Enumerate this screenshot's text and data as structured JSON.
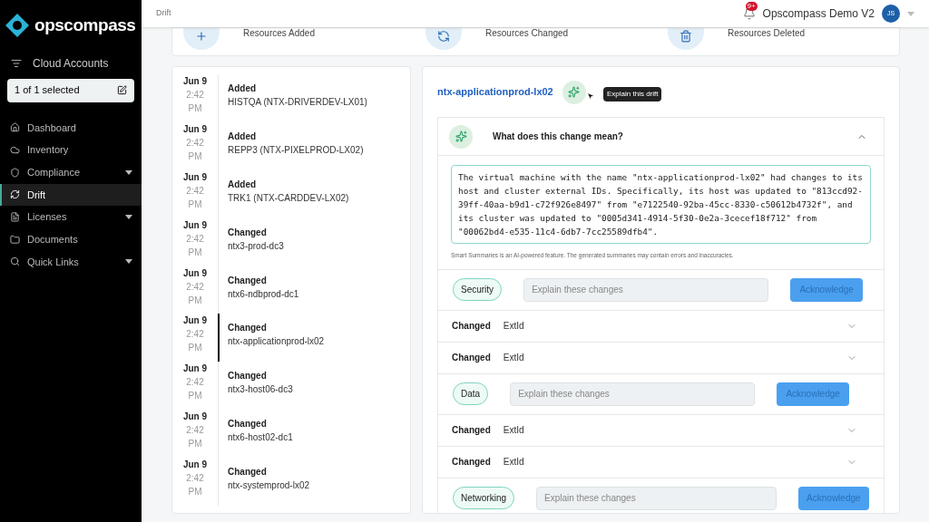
{
  "brand": {
    "name": "opscompass"
  },
  "sidebar": {
    "filter_label": "Cloud Accounts",
    "account_selector": "1 of 1 selected",
    "items": [
      {
        "label": "Dashboard",
        "expandable": false,
        "selected": false
      },
      {
        "label": "Inventory",
        "expandable": false,
        "selected": false
      },
      {
        "label": "Compliance",
        "expandable": true,
        "selected": false
      },
      {
        "label": "Drift",
        "expandable": false,
        "selected": true
      },
      {
        "label": "Licenses",
        "expandable": true,
        "selected": false
      },
      {
        "label": "Documents",
        "expandable": false,
        "selected": false
      },
      {
        "label": "Quick Links",
        "expandable": true,
        "selected": false
      }
    ]
  },
  "header": {
    "breadcrumb": "Drift",
    "notification_badge": "9+",
    "account": "Opscompass Demo V2",
    "avatar": "JS"
  },
  "stats": [
    {
      "label": "Resources Added"
    },
    {
      "label": "Resources Changed"
    },
    {
      "label": "Resources Deleted"
    }
  ],
  "feed": [
    {
      "date": "Jun 9",
      "time": "2:42",
      "ampm": "PM",
      "action": "Added",
      "resource": "HISTQA (NTX-DRIVERDEV-LX01)",
      "selected": false
    },
    {
      "date": "Jun 9",
      "time": "2:42",
      "ampm": "PM",
      "action": "Added",
      "resource": "REPP3 (NTX-PIXELPROD-LX02)",
      "selected": false
    },
    {
      "date": "Jun 9",
      "time": "2:42",
      "ampm": "PM",
      "action": "Added",
      "resource": "TRK1 (NTX-CARDDEV-LX02)",
      "selected": false
    },
    {
      "date": "Jun 9",
      "time": "2:42",
      "ampm": "PM",
      "action": "Changed",
      "resource": "ntx3-prod-dc3",
      "selected": false
    },
    {
      "date": "Jun 9",
      "time": "2:42",
      "ampm": "PM",
      "action": "Changed",
      "resource": "ntx6-ndbprod-dc1",
      "selected": false
    },
    {
      "date": "Jun 9",
      "time": "2:42",
      "ampm": "PM",
      "action": "Changed",
      "resource": "ntx-applicationprod-lx02",
      "selected": true
    },
    {
      "date": "Jun 9",
      "time": "2:42",
      "ampm": "PM",
      "action": "Changed",
      "resource": "ntx3-host06-dc3",
      "selected": false
    },
    {
      "date": "Jun 9",
      "time": "2:42",
      "ampm": "PM",
      "action": "Changed",
      "resource": "ntx6-host02-dc1",
      "selected": false
    },
    {
      "date": "Jun 9",
      "time": "2:42",
      "ampm": "PM",
      "action": "Changed",
      "resource": "ntx-systemprod-lx02",
      "selected": false
    }
  ],
  "detail": {
    "title": "ntx-applicationprod-lx02",
    "tooltip": "Explain this drift",
    "summary": {
      "heading": "What does this change mean?",
      "expanded": true,
      "text": "The virtual machine with the name \"ntx-applicationprod-lx02\" had changes to its host and cluster external IDs. Specifically, its host was updated to \"813ccd92-39ff-40aa-b9d1-c72f926e8497\" from \"e7122540-92ba-45cc-8330-c50612b4732f\", and its cluster was updated to \"0005d341-4914-5f30-0e2a-3cecef18f712\" from \"00062bd4-e535-11c4-6db7-7cc25589dfb4\".",
      "disclaimer": "Smart Summaries is an AI-powered feature. The generated summaries may contain errors and inaccuracies."
    },
    "rows": [
      {
        "kind": "category",
        "tag": "Security",
        "placeholder": "Explain these changes",
        "button": "Acknowledge"
      },
      {
        "kind": "change",
        "action": "Changed",
        "field": "ExtId",
        "expanded": false
      },
      {
        "kind": "change",
        "action": "Changed",
        "field": "ExtId",
        "expanded": false
      },
      {
        "kind": "category",
        "tag": "Data",
        "placeholder": "Explain these changes",
        "button": "Acknowledge"
      },
      {
        "kind": "change",
        "action": "Changed",
        "field": "ExtId",
        "expanded": false
      },
      {
        "kind": "change",
        "action": "Changed",
        "field": "ExtId",
        "expanded": false
      },
      {
        "kind": "category",
        "tag": "Networking",
        "placeholder": "Explain these changes",
        "button": "Acknowledge"
      }
    ]
  }
}
